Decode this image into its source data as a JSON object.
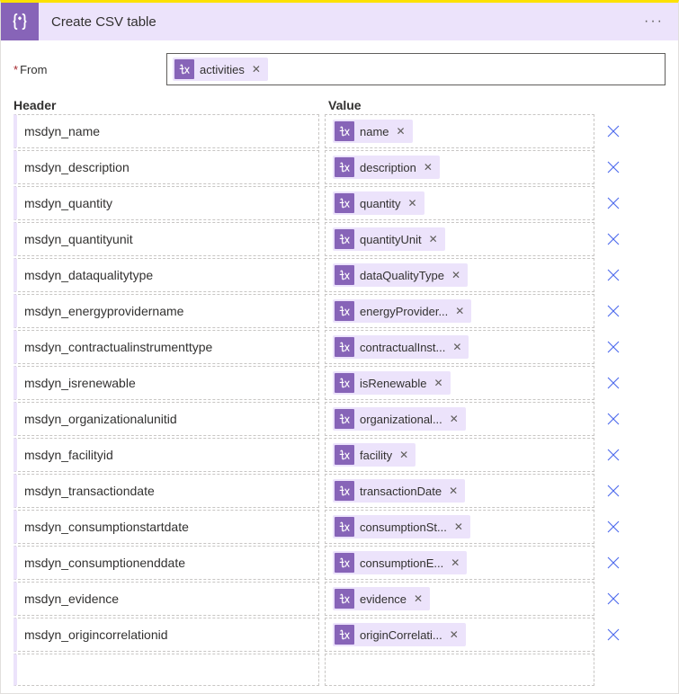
{
  "title": "Create CSV table",
  "from": {
    "label": "From",
    "token": "activities"
  },
  "columns": {
    "header": "Header",
    "value": "Value"
  },
  "rows": [
    {
      "header": "msdyn_name",
      "token": "name"
    },
    {
      "header": "msdyn_description",
      "token": "description"
    },
    {
      "header": "msdyn_quantity",
      "token": "quantity"
    },
    {
      "header": "msdyn_quantityunit",
      "token": "quantityUnit"
    },
    {
      "header": "msdyn_dataqualitytype",
      "token": "dataQualityType"
    },
    {
      "header": "msdyn_energyprovidername",
      "token": "energyProvider..."
    },
    {
      "header": "msdyn_contractualinstrumenttype",
      "token": "contractualInst..."
    },
    {
      "header": "msdyn_isrenewable",
      "token": "isRenewable"
    },
    {
      "header": "msdyn_organizationalunitid",
      "token": "organizational..."
    },
    {
      "header": "msdyn_facilityid",
      "token": "facility"
    },
    {
      "header": "msdyn_transactiondate",
      "token": "transactionDate"
    },
    {
      "header": "msdyn_consumptionstartdate",
      "token": "consumptionSt..."
    },
    {
      "header": "msdyn_consumptionenddate",
      "token": "consumptionE..."
    },
    {
      "header": "msdyn_evidence",
      "token": "evidence"
    },
    {
      "header": "msdyn_origincorrelationid",
      "token": "originCorrelati..."
    }
  ]
}
